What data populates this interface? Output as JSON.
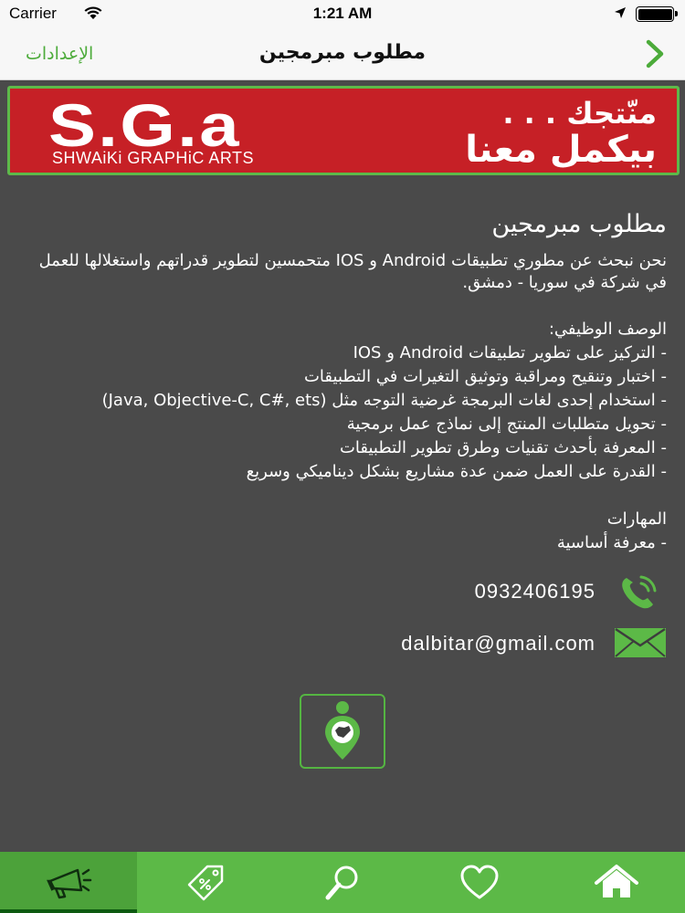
{
  "status_bar": {
    "carrier": "Carrier",
    "time": "1:21 AM",
    "battery_level": 1.0
  },
  "nav": {
    "settings_label": "الإعدادات",
    "title": "مطلوب مبرمجين",
    "forward_icon": "chevron-right-icon"
  },
  "banner": {
    "logo_text": "S.G.a",
    "logo_subtitle": "SHWAiKi GRAPHiC ARTS",
    "slogan_line1": "منّتجك . . .",
    "slogan_line2": "بيكمل معنا",
    "background_color": "#c62026",
    "border_color": "#5db94a"
  },
  "post": {
    "title": "مطلوب مبرمجين",
    "intro": "نحن نبحث عن مطوري تطبيقات Android و IOS متحمسين لتطوير قدراتهم واستغلالها للعمل في شركة في سوريا - دمشق.",
    "description_heading": "الوصف الوظيفي:",
    "description_items": [
      "- التركيز على تطوير تطبيقات Android و IOS",
      "- اختبار وتنقيح ومراقبة وتوثيق التغيرات في التطبيقات",
      "- استخدام إحدى لغات البرمجة غرضية التوجه مثل (Java, Objective-C, C#, ets)",
      "- تحويل متطلبات المنتج إلى نماذج عمل برمجية",
      "- المعرفة بأحدث تقنيات وطرق تطوير التطبيقات",
      "- القدرة على العمل ضمن عدة مشاريع بشكل ديناميكي وسريع"
    ],
    "skills_heading": "المهارات",
    "skills_items": [
      "- معرفة أساسية"
    ]
  },
  "contact": {
    "phone": "0932406195",
    "email": "dalbitar@gmail.com",
    "phone_icon": "phone-icon",
    "email_icon": "envelope-icon"
  },
  "map_button": {
    "icon": "map-pin-icon"
  },
  "tabs": [
    {
      "icon": "megaphone-icon",
      "active": true
    },
    {
      "icon": "price-tag-icon",
      "active": false
    },
    {
      "icon": "search-icon",
      "active": false
    },
    {
      "icon": "heart-icon",
      "active": false
    },
    {
      "icon": "home-icon",
      "active": false
    }
  ],
  "colors": {
    "accent": "#5cb947",
    "background": "#4a4a4a",
    "nav_bar": "#f7f7f7"
  }
}
